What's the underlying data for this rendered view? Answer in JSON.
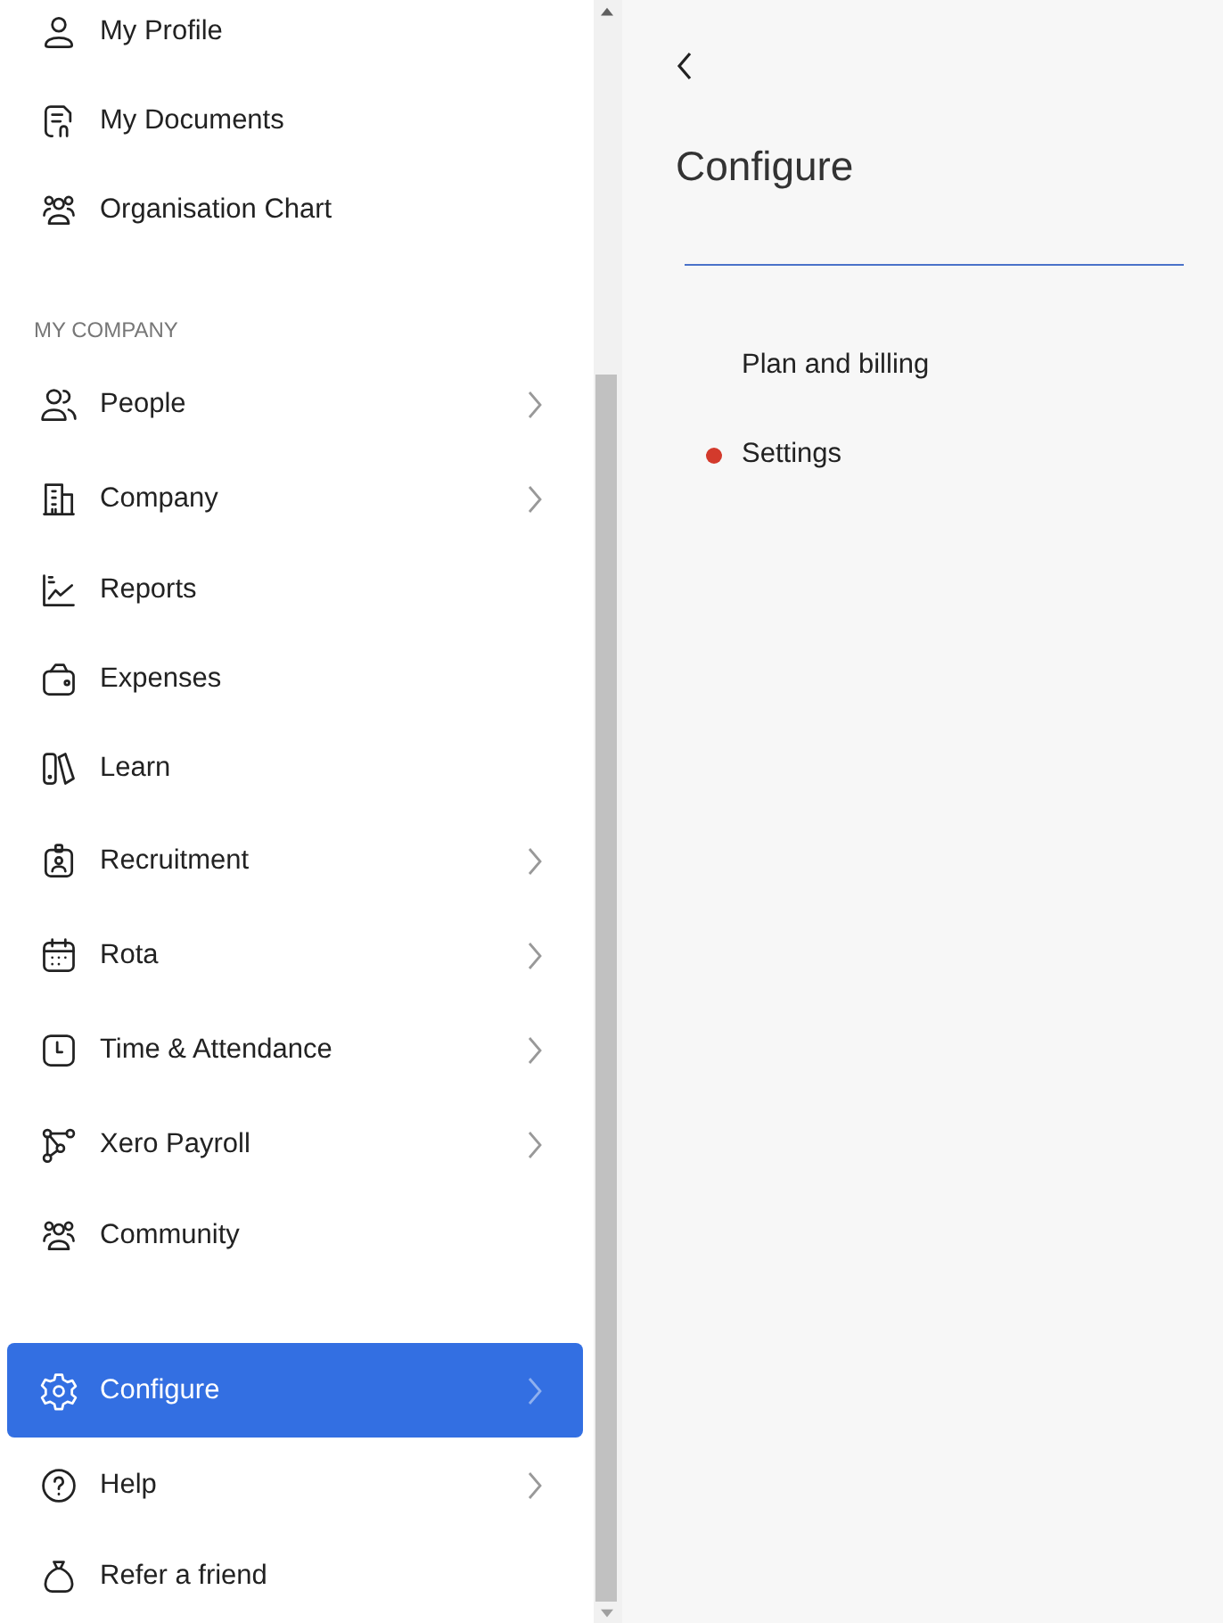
{
  "sidebar": {
    "sections": [
      {
        "items": [
          {
            "label": "My Profile",
            "submenu": false,
            "selected": false
          },
          {
            "label": "My Documents",
            "submenu": false,
            "selected": false
          },
          {
            "label": "Organisation Chart",
            "submenu": false,
            "selected": false
          }
        ]
      },
      {
        "heading": "MY COMPANY",
        "items": [
          {
            "label": "People",
            "submenu": true,
            "selected": false
          },
          {
            "label": "Company",
            "submenu": true,
            "selected": false
          },
          {
            "label": "Reports",
            "submenu": false,
            "selected": false
          },
          {
            "label": "Expenses",
            "submenu": false,
            "selected": false
          },
          {
            "label": "Learn",
            "submenu": false,
            "selected": false
          },
          {
            "label": "Recruitment",
            "submenu": true,
            "selected": false
          },
          {
            "label": "Rota",
            "submenu": true,
            "selected": false
          },
          {
            "label": "Time & Attendance",
            "submenu": true,
            "selected": false
          },
          {
            "label": "Xero Payroll",
            "submenu": true,
            "selected": false
          },
          {
            "label": "Community",
            "submenu": false,
            "selected": false
          }
        ]
      },
      {
        "items": [
          {
            "label": "Configure",
            "submenu": true,
            "selected": true
          },
          {
            "label": "Help",
            "submenu": true,
            "selected": false
          },
          {
            "label": "Refer a friend",
            "submenu": false,
            "selected": false
          }
        ]
      }
    ]
  },
  "panel": {
    "title": "Configure",
    "items": [
      {
        "label": "Plan and billing",
        "marked": false
      },
      {
        "label": "Settings",
        "marked": true
      }
    ]
  }
}
